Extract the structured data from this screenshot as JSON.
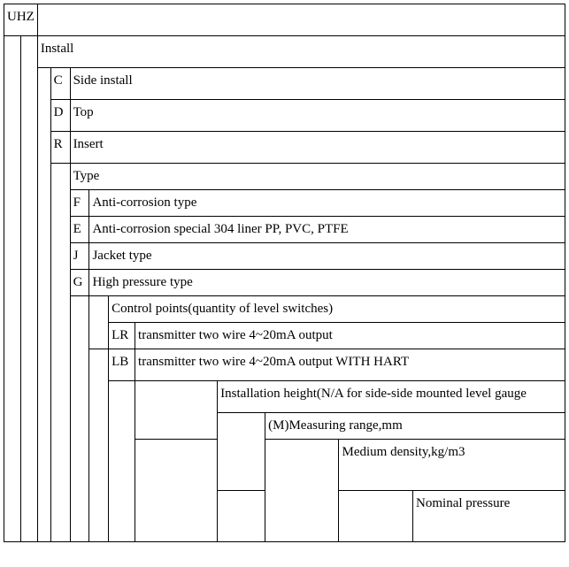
{
  "root_code": "UHZ",
  "install": {
    "header": "Install",
    "options": [
      {
        "code": "C",
        "label": "Side install"
      },
      {
        "code": "D",
        "label": "Top"
      },
      {
        "code": "R",
        "label": "Insert"
      }
    ]
  },
  "type": {
    "header": "Type",
    "options": [
      {
        "code": "F",
        "label": "Anti-corrosion type"
      },
      {
        "code": "E",
        "label": "Anti-corrosion special 304 liner PP, PVC, PTFE"
      },
      {
        "code": "J",
        "label": "Jacket type"
      },
      {
        "code": "G",
        "label": "High pressure type"
      }
    ]
  },
  "control": {
    "header": "Control points(quantity of level switches)",
    "options": [
      {
        "code": "LR",
        "label": "transmitter two wire 4~20mA output"
      },
      {
        "code": "LB",
        "label": "transmitter two wire 4~20mA output WITH HART"
      }
    ]
  },
  "params": {
    "installation_height": "Installation height(N/A for side-side mounted level gauge",
    "measuring_range": "(M)Measuring range,mm",
    "medium_density": "Medium density,kg/m3",
    "nominal_pressure": "Nominal pressure"
  }
}
